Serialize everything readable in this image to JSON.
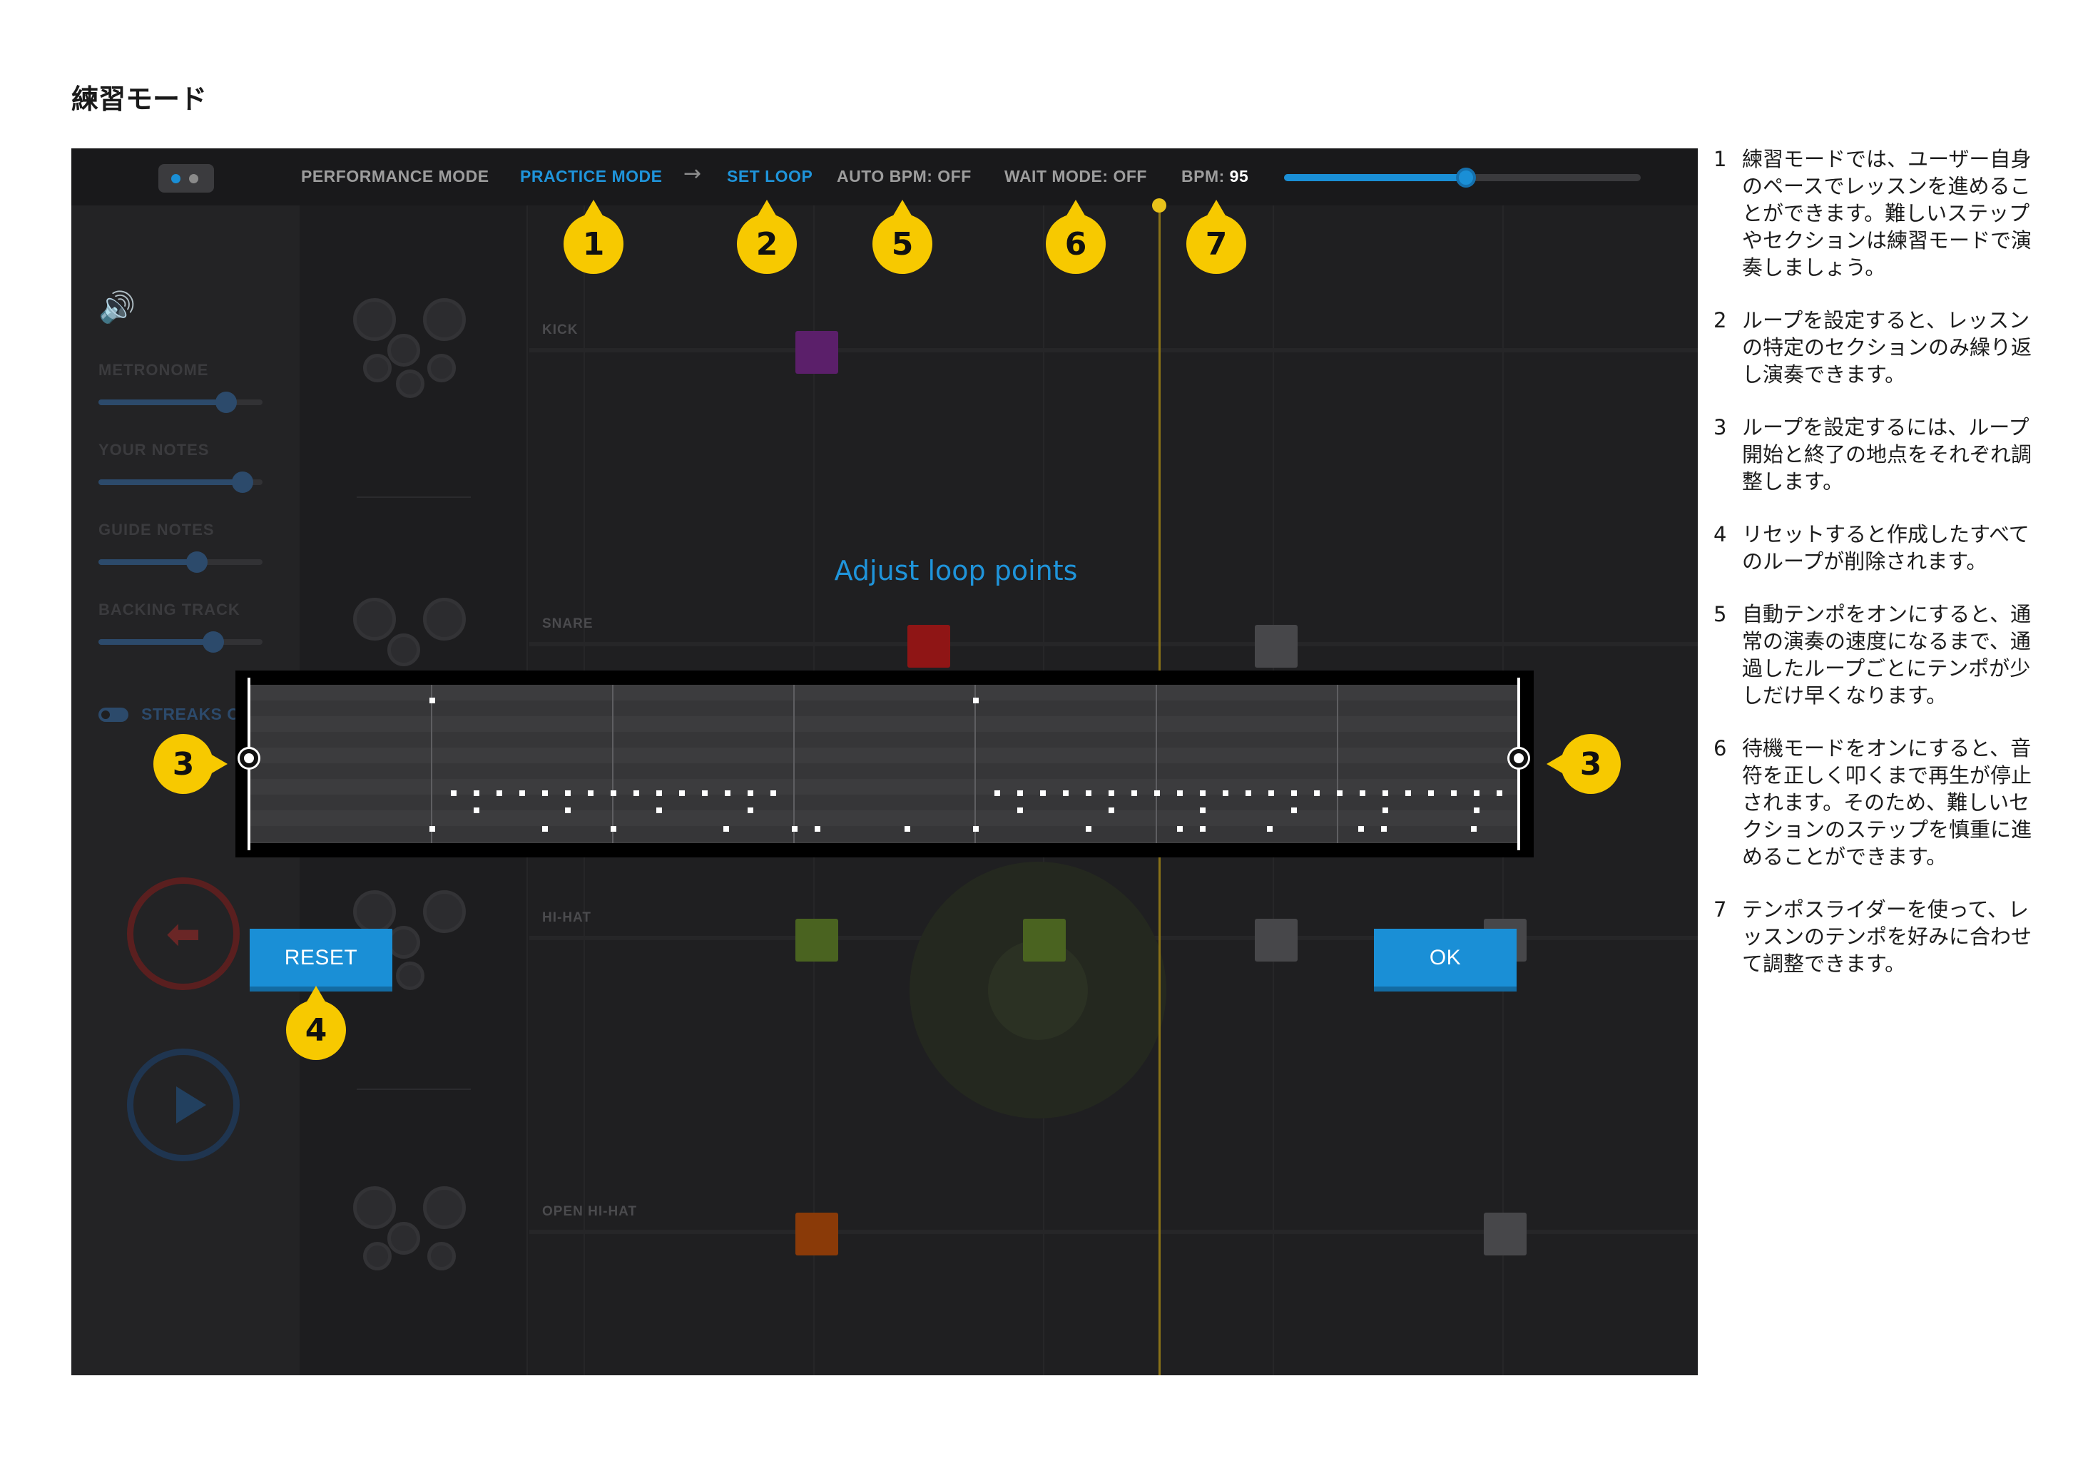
{
  "page": {
    "title": "練習モード"
  },
  "topbar": {
    "performance_mode": "PERFORMANCE MODE",
    "practice_mode": "PRACTICE MODE",
    "set_loop": "SET LOOP",
    "auto_bpm_label": "AUTO BPM:",
    "auto_bpm_value": "OFF",
    "wait_mode_label": "WAIT MODE:",
    "wait_mode_value": "OFF",
    "bpm_label": "BPM:",
    "bpm_value": "95",
    "bpm_slider_fraction": 0.51
  },
  "mixer": {
    "items": [
      {
        "label": "METRONOME",
        "level": 0.78
      },
      {
        "label": "YOUR NOTES",
        "level": 0.88
      },
      {
        "label": "GUIDE NOTES",
        "level": 0.6
      },
      {
        "label": "BACKING TRACK",
        "level": 0.7
      }
    ],
    "streaks_label": "STREAKS ON"
  },
  "lanes": [
    "KICK",
    "SNARE",
    "HI-HAT",
    "OPEN HI-HAT"
  ],
  "dialog": {
    "title": "Adjust loop points",
    "reset_label": "RESET",
    "ok_label": "OK"
  },
  "callouts": [
    "1",
    "2",
    "5",
    "6",
    "7",
    "3",
    "3",
    "4"
  ],
  "notes": [
    {
      "num": "1",
      "text": "練習モードでは、ユーザー自身のペースでレッスンを進めることができます。難しいステップやセクションは練習モードで演奏しましょう。"
    },
    {
      "num": "2",
      "text": "ループを設定すると、レッスンの特定のセクションのみ繰り返し演奏できます。"
    },
    {
      "num": "3",
      "text": "ループを設定するには、ループ開始と終了の地点をそれぞれ調整します。"
    },
    {
      "num": "4",
      "text": "リセットすると作成したすべてのループが削除されます。"
    },
    {
      "num": "5",
      "text": "自動テンポをオンにすると、通常の演奏の速度になるまで、通過したループごとにテンポが少しだけ早くなります。"
    },
    {
      "num": "6",
      "text": "待機モードをオンにすると、音符を正しく叩くまで再生が停止されます。そのため、難しいセクションのステップを慎重に進めることができます。"
    },
    {
      "num": "7",
      "text": "テンポスライダーを使って、レッスンのテンポを好みに合わせて調整できます。"
    }
  ],
  "colors": {
    "accent": "#1a8fd6",
    "callout": "#f7c900",
    "kick": "#5b1f6a",
    "snare": "#8f1515",
    "hihat": "#4a6320",
    "open_hihat": "#8a3a08",
    "inactive": "#47474a"
  }
}
